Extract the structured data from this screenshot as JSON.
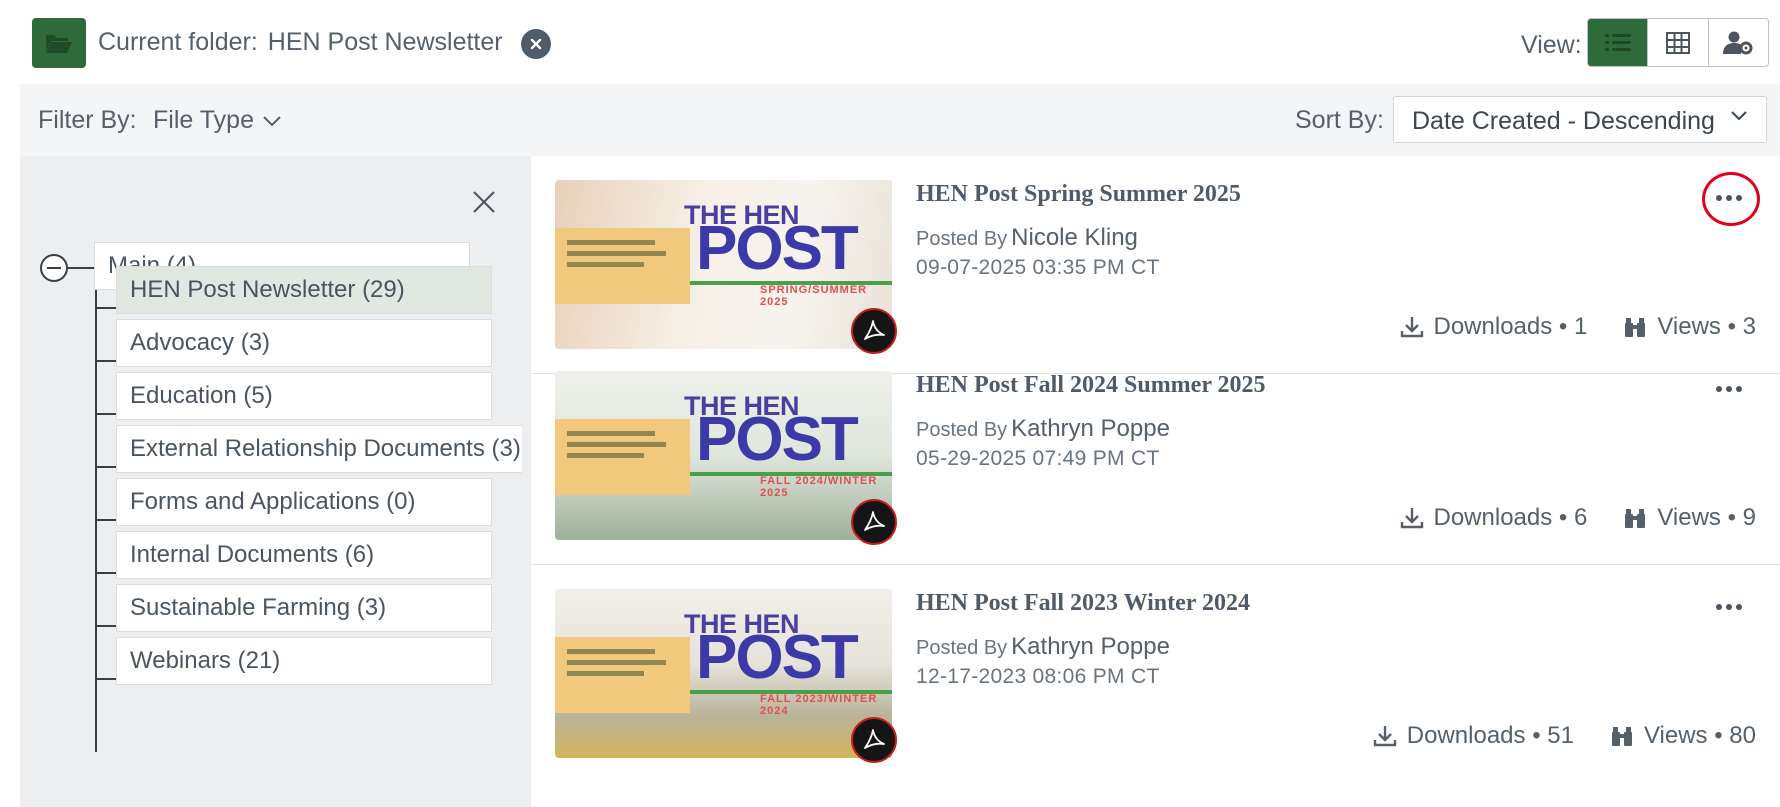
{
  "header": {
    "folder_prefix": "Current folder:",
    "folder_name": "HEN Post Newsletter",
    "view_label": "View:",
    "view_options": [
      "list-icon",
      "grid-icon",
      "user-gear-icon"
    ],
    "active_view": "list"
  },
  "filter": {
    "label": "Filter By:",
    "file_type": "File Type",
    "sort_label": "Sort By:",
    "sort_value": "Date Created - Descending"
  },
  "sidebar": {
    "root": "Main (4)",
    "items": [
      {
        "label": "HEN Post Newsletter (29)",
        "selected": true
      },
      {
        "label": "Advocacy (3)"
      },
      {
        "label": "Education (5)"
      },
      {
        "label": "External Relationship Documents (3)"
      },
      {
        "label": "Forms and Applications (0)"
      },
      {
        "label": "Internal Documents (6)"
      },
      {
        "label": "Sustainable Farming (3)"
      },
      {
        "label": "Webinars (21)"
      }
    ]
  },
  "files": [
    {
      "title": "HEN Post Spring Summer 2025",
      "posted_by": "Posted By",
      "author": "Nicole Kling",
      "date": "09-07-2025 03:35 PM CT",
      "downloads": "Downloads • 1",
      "views": "Views • 3",
      "thumb": {
        "line1": "THE HEN",
        "line2": "POST",
        "season": "SPRING/SUMMER 2025"
      }
    },
    {
      "title": "HEN Post Fall 2024 Summer 2025",
      "posted_by": "Posted By",
      "author": "Kathryn Poppe",
      "date": "05-29-2025 07:49 PM CT",
      "downloads": "Downloads • 6",
      "views": "Views • 9",
      "thumb": {
        "line1": "THE HEN",
        "line2": "POST",
        "season": "FALL 2024/WINTER 2025"
      }
    },
    {
      "title": "HEN Post Fall 2023 Winter 2024",
      "posted_by": "Posted By",
      "author": "Kathryn Poppe",
      "date": "12-17-2023 08:06 PM CT",
      "downloads": "Downloads • 51",
      "views": "Views • 80",
      "thumb": {
        "line1": "THE HEN",
        "line2": "POST",
        "season": "FALL 2023/WINTER 2024"
      }
    }
  ],
  "colors": {
    "brand_green": "#2f6b3a",
    "highlight_red": "#e3001b",
    "pdf_badge": "#151515"
  }
}
